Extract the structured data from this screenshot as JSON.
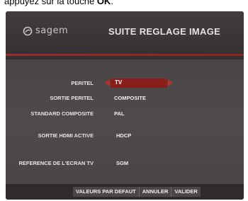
{
  "caption": {
    "text_before": "appuyez sur la touche ",
    "key": "OK",
    "text_after": "."
  },
  "header": {
    "brand": "sagem",
    "title": "SUITE REGLAGE IMAGE"
  },
  "settings": [
    {
      "label": "PERITEL",
      "value": "TV"
    },
    {
      "label": "SORTIE PERITEL",
      "value": "COMPOSITE"
    },
    {
      "label": "STANDARD COMPOSITE",
      "value": "PAL"
    },
    {
      "label": "SORTIE HDMI ACTIVE",
      "value": "HDCP"
    },
    {
      "label": "REFERENCE DE L'ECRAN TV",
      "value": "SGM"
    }
  ],
  "footer": {
    "defaults": "VALEURS PAR DEFAUT",
    "cancel": "ANNULER",
    "validate": "VALIDER"
  },
  "colors": {
    "accent": "#8a1e1b",
    "panel": "#4b4647"
  }
}
